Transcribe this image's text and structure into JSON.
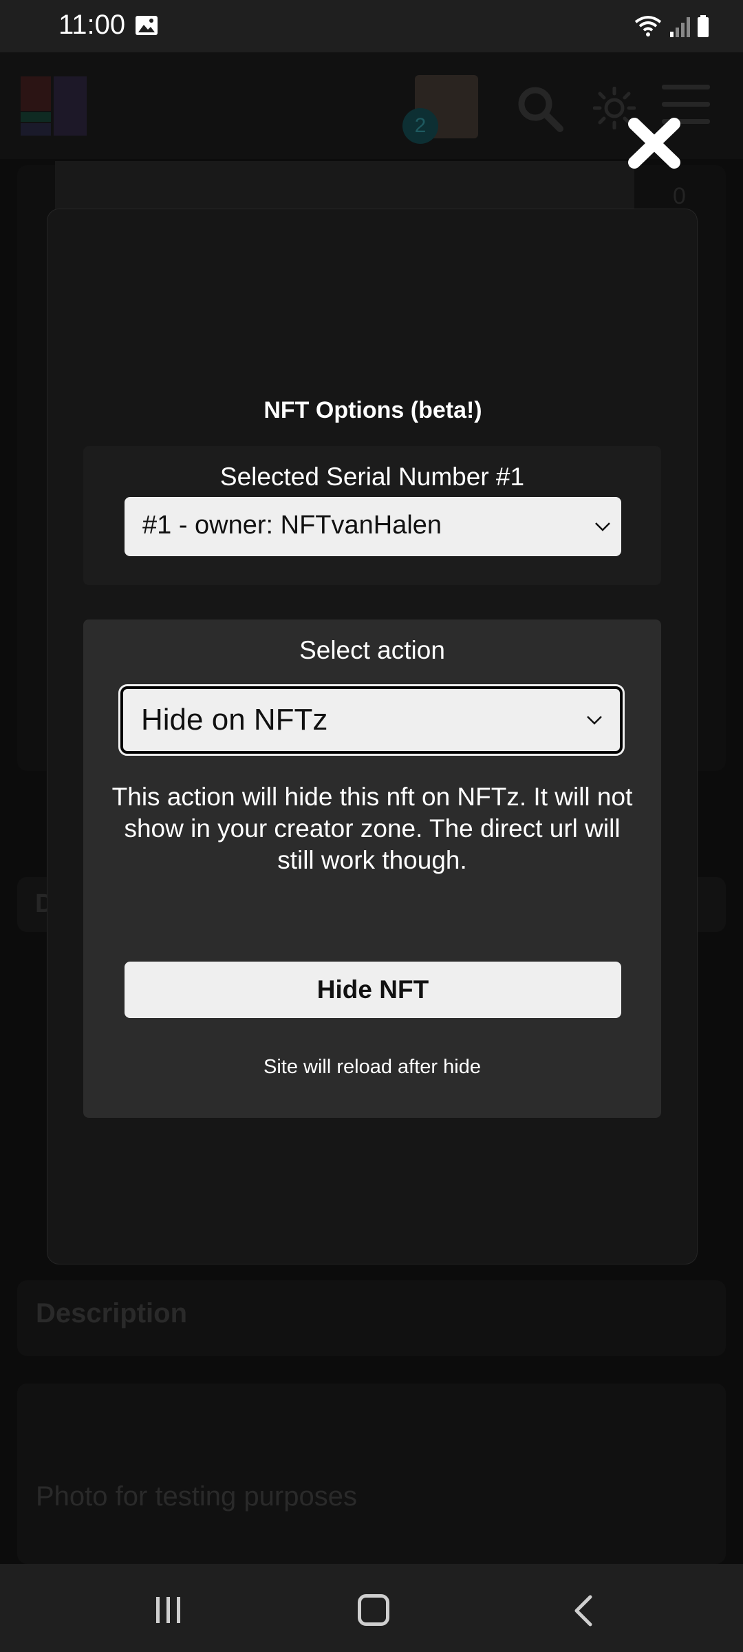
{
  "status_bar": {
    "time": "11:00"
  },
  "background_page": {
    "notification_count": "2",
    "counter": "0",
    "tab_letter": "D",
    "description_title": "Description",
    "description_body": "Photo for testing purposes"
  },
  "modal": {
    "title": "NFT Options (beta!)",
    "serial_label": "Selected Serial Number #1",
    "serial_select_value": "#1 - owner: NFTvanHalen",
    "action_label": "Select action",
    "action_select_value": "Hide on NFTz",
    "action_description": "This action will hide this nft on NFTz. It will not show in your creator zone. The direct url will still work though.",
    "hide_button_label": "Hide NFT",
    "reload_note": "Site will reload after hide"
  },
  "icons": {
    "close": "close-icon",
    "search": "search-icon",
    "theme": "sun-icon",
    "menu": "hamburger-menu-icon",
    "nav_recent": "recent-apps-icon",
    "nav_home": "home-icon",
    "nav_back": "back-icon"
  },
  "colors": {
    "modal_bg": "#161616",
    "action_box_bg": "#2c2c2c",
    "select_bg": "#efefef",
    "text": "#ffffff"
  }
}
